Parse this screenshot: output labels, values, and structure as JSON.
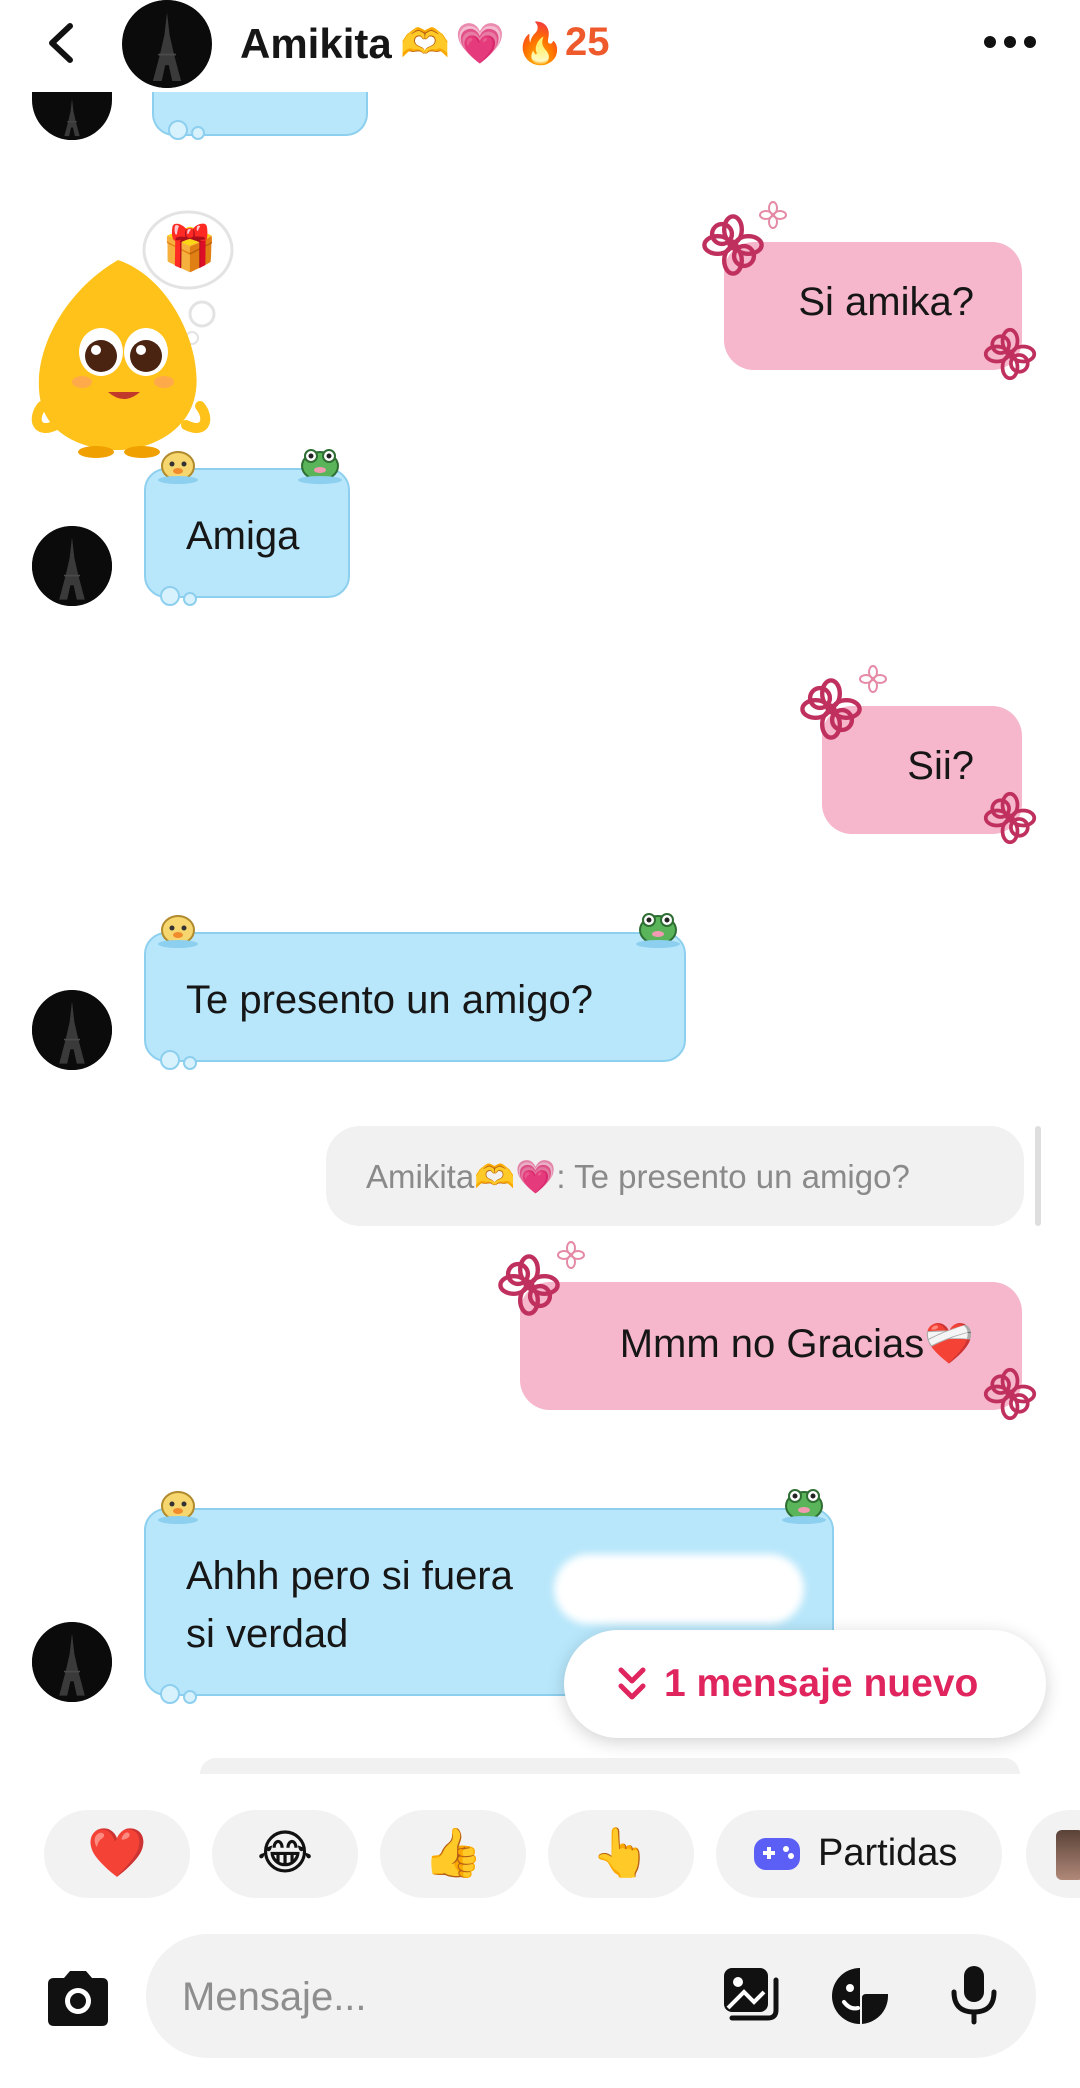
{
  "header": {
    "back_icon": "chevron-left-icon",
    "contact_name": "Amikita",
    "name_emojis": [
      "🫶",
      "💗"
    ],
    "streak_emoji": "🔥",
    "streak_count": "25",
    "more_icon": "more-horizontal-icon"
  },
  "messages": [
    {
      "direction": "out",
      "text": "Si amika?"
    },
    {
      "direction": "in",
      "text": "Amiga"
    },
    {
      "direction": "out",
      "text": "Sii?"
    },
    {
      "direction": "in",
      "text": "Te presento un amigo?"
    },
    {
      "direction": "reply_quote",
      "text": "Amikita🫶💗: Te presento un amigo?"
    },
    {
      "direction": "out",
      "text": "Mmm no Gracias❤️‍🩹"
    },
    {
      "direction": "in",
      "line1": "Ahhh pero si fuera",
      "line2": "si verdad"
    }
  ],
  "sticker": {
    "name": "gift-sticker",
    "emoji": "🎁"
  },
  "new_message_pill": {
    "icon": "chevrons-down-icon",
    "label": "1 mensaje nuevo"
  },
  "quick_reactions": [
    {
      "name": "heart",
      "emoji": "❤️"
    },
    {
      "name": "laugh",
      "emoji": "😂"
    },
    {
      "name": "thumbs-up",
      "emoji": "👍"
    },
    {
      "name": "point",
      "emoji": "👆"
    }
  ],
  "games_button": {
    "icon": "gamepad-icon",
    "label": "Partidas"
  },
  "composer": {
    "placeholder": "Mensaje...",
    "camera_icon": "camera-icon",
    "gallery_icon": "gallery-icon",
    "sticker_icon": "sticker-icon",
    "mic_icon": "microphone-icon"
  },
  "colors": {
    "received_bubble": "#b8e7fb",
    "sent_bubble": "#f6b6cb",
    "accent": "#e0245e",
    "streak": "#ee5a2c"
  }
}
